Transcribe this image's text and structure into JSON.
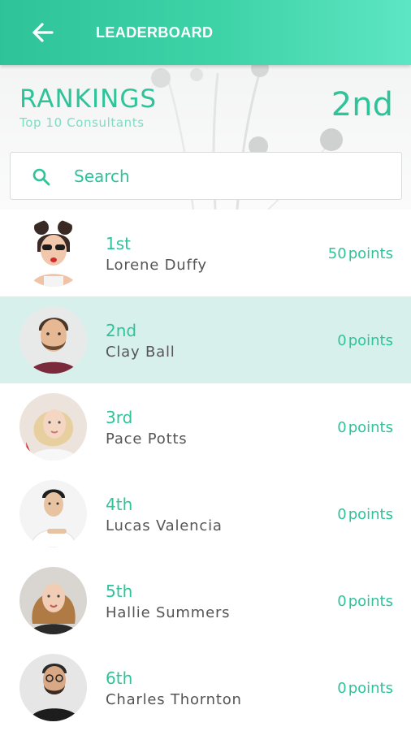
{
  "appbar": {
    "title": "LEADERBOARD"
  },
  "hero": {
    "title": "RANKINGS",
    "subtitle": "Top 10 Consultants",
    "current_rank": "2nd"
  },
  "search": {
    "placeholder": "Search"
  },
  "colors": {
    "accent": "#2fc39a",
    "highlight_row": "#d8f0ec"
  },
  "leaderboard": [
    {
      "rank": "1st",
      "name": "Lorene Duffy",
      "points": "50",
      "unit": "points",
      "active": false
    },
    {
      "rank": "2nd",
      "name": "Clay Ball",
      "points": "0",
      "unit": "points",
      "active": true
    },
    {
      "rank": "3rd",
      "name": "Pace Potts",
      "points": "0",
      "unit": "points",
      "active": false
    },
    {
      "rank": "4th",
      "name": "Lucas Valencia",
      "points": "0",
      "unit": "points",
      "active": false
    },
    {
      "rank": "5th",
      "name": "Hallie Summers",
      "points": "0",
      "unit": "points",
      "active": false
    },
    {
      "rank": "6th",
      "name": "Charles Thornton",
      "points": "0",
      "unit": "points",
      "active": false
    }
  ]
}
